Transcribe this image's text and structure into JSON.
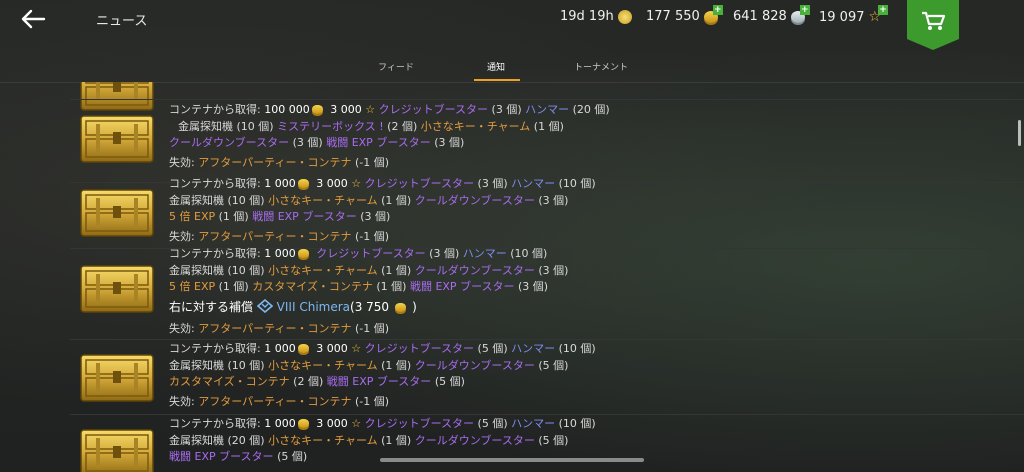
{
  "header": {
    "title": "ニュース",
    "timer": "19d 19h",
    "credits": "177 550",
    "silver": "641 828",
    "gold": "19 097",
    "accent": "#3d9b2e"
  },
  "tabs": [
    {
      "label": "フィード"
    },
    {
      "label": "通知"
    },
    {
      "label": "トーナメント"
    }
  ],
  "entries": [
    {
      "from_label": "コンテナから取得:",
      "credits": "100 000",
      "stars": "3 000",
      "lines": [
        [
          {
            "t": "クレジットブースター",
            "c": "p"
          },
          {
            "t": "(3 個)"
          },
          {
            "t": "ハンマー",
            "c": "b"
          },
          {
            "t": "(20 個)"
          }
        ],
        [
          {
            "t": "金属探知機",
            "c": "lbl"
          },
          {
            "t": "(10 個)"
          },
          {
            "t": "ミステリーボックス !",
            "c": "p"
          },
          {
            "t": "(2 個)"
          },
          {
            "t": "小さなキー・チャーム",
            "c": "o"
          },
          {
            "t": "(1 個)"
          }
        ],
        [
          {
            "t": "クールダウンブースター",
            "c": "p"
          },
          {
            "t": "(3 個)"
          },
          {
            "t": "戦闘 EXP ブースター",
            "c": "p"
          },
          {
            "t": "(3 個)"
          }
        ]
      ],
      "loss_label": "失効:",
      "loss_item": "アフターパーティー・コンテナ",
      "loss_count": "(-1 個)"
    },
    {
      "from_label": "コンテナから取得:",
      "credits": "1 000",
      "stars": "3 000",
      "lines": [
        [
          {
            "t": "クレジットブースター",
            "c": "p"
          },
          {
            "t": "(3 個)"
          },
          {
            "t": "ハンマー",
            "c": "b"
          },
          {
            "t": "(10 個)"
          }
        ],
        [
          {
            "t": "金属探知機",
            "c": "lbl"
          },
          {
            "t": "(10 個)"
          },
          {
            "t": "小さなキー・チャーム",
            "c": "o"
          },
          {
            "t": "(1 個)"
          },
          {
            "t": "クールダウンブースター",
            "c": "p"
          },
          {
            "t": "(3 個)"
          }
        ],
        [
          {
            "t": "5 倍 EXP",
            "c": "o"
          },
          {
            "t": "(1 個)"
          },
          {
            "t": "戦闘 EXP ブースター",
            "c": "p"
          },
          {
            "t": "(3 個)"
          }
        ]
      ],
      "loss_label": "失効:",
      "loss_item": "アフターパーティー・コンテナ",
      "loss_count": "(-1 個)"
    },
    {
      "from_label": "コンテナから取得:",
      "credits": "1 000",
      "lines": [
        [
          {
            "t": "クレジットブースター",
            "c": "p"
          },
          {
            "t": "(3 個)"
          },
          {
            "t": "ハンマー",
            "c": "b"
          },
          {
            "t": "(10 個)"
          }
        ],
        [
          {
            "t": "金属探知機",
            "c": "lbl"
          },
          {
            "t": "(10 個)"
          },
          {
            "t": "小さなキー・チャーム",
            "c": "o"
          },
          {
            "t": "(1 個)"
          },
          {
            "t": "クールダウンブースター",
            "c": "p"
          },
          {
            "t": "(3 個)"
          }
        ],
        [
          {
            "t": "5 倍 EXP",
            "c": "o"
          },
          {
            "t": "(1 個)"
          },
          {
            "t": "カスタマイズ・コンテナ",
            "c": "o"
          },
          {
            "t": "(1 個)"
          },
          {
            "t": "戦闘 EXP ブースター",
            "c": "p"
          },
          {
            "t": "(3 個)"
          }
        ]
      ],
      "compensation": {
        "label": "右に対する補償",
        "tier": "VIII",
        "name": "Chimera",
        "paren_open": "(",
        "amount": "3 750",
        "paren_close": ")"
      },
      "loss_label": "失効:",
      "loss_item": "アフターパーティー・コンテナ",
      "loss_count": "(-1 個)"
    },
    {
      "from_label": "コンテナから取得:",
      "credits": "1 000",
      "stars": "3 000",
      "lines": [
        [
          {
            "t": "クレジットブースター",
            "c": "p"
          },
          {
            "t": "(5 個)"
          },
          {
            "t": "ハンマー",
            "c": "b"
          },
          {
            "t": "(10 個)"
          }
        ],
        [
          {
            "t": "金属探知機",
            "c": "lbl"
          },
          {
            "t": "(10 個)"
          },
          {
            "t": "小さなキー・チャーム",
            "c": "o"
          },
          {
            "t": "(1 個)"
          },
          {
            "t": "クールダウンブースター",
            "c": "p"
          },
          {
            "t": "(5 個)"
          }
        ],
        [
          {
            "t": "カスタマイズ・コンテナ",
            "c": "o"
          },
          {
            "t": "(2 個)"
          },
          {
            "t": "戦闘 EXP ブースター",
            "c": "p"
          },
          {
            "t": "(5 個)"
          }
        ]
      ],
      "loss_label": "失効:",
      "loss_item": "アフターパーティー・コンテナ",
      "loss_count": "(-1 個)"
    },
    {
      "from_label": "コンテナから取得:",
      "credits": "1 000",
      "stars": "3 000",
      "lines": [
        [
          {
            "t": "クレジットブースター",
            "c": "p"
          },
          {
            "t": "(5 個)"
          },
          {
            "t": "ハンマー",
            "c": "b"
          },
          {
            "t": "(10 個)"
          }
        ],
        [
          {
            "t": "金属探知機",
            "c": "lbl"
          },
          {
            "t": "(20 個)"
          },
          {
            "t": "小さなキー・チャーム",
            "c": "o"
          },
          {
            "t": "(1 個)"
          },
          {
            "t": "クールダウンブースター",
            "c": "p"
          },
          {
            "t": "(5 個)"
          }
        ],
        [
          {
            "t": "戦闘 EXP ブースター",
            "c": "p"
          },
          {
            "t": "(5 個)"
          }
        ]
      ]
    }
  ]
}
